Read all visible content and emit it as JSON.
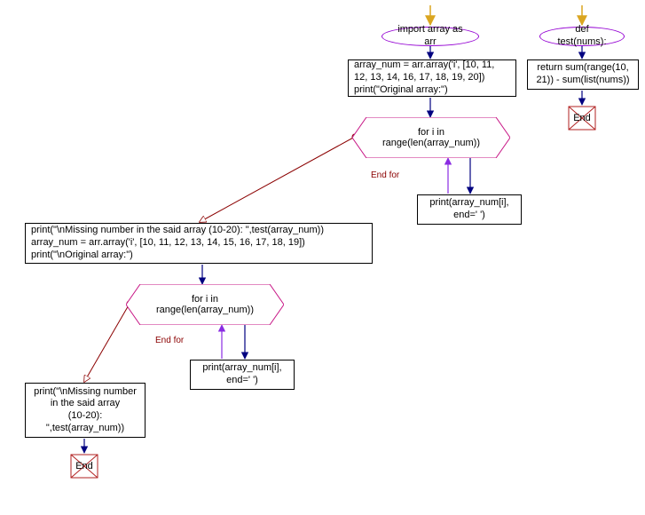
{
  "main": {
    "entry": "import array as arr",
    "block1": "array_num = arr.array('i', [10, 11, 12, 13, 14, 16, 17, 18, 19, 20])\nprint(\"Original array:\")",
    "loop1": "for i in\nrange(len(array_num))",
    "loop1_body": "print(array_num[i],\nend=' ')",
    "loop1_end_label": "End for",
    "block2": "print(\"\\nMissing number in the said array (10-20): \",test(array_num))\narray_num = arr.array('i', [10, 11, 12, 13, 14, 15, 16, 17, 18, 19])\nprint(\"\\nOriginal array:\")",
    "loop2": "for i in\nrange(len(array_num))",
    "loop2_body": "print(array_num[i],\nend=' ')",
    "loop2_end_label": "End for",
    "block3": "print(\"\\nMissing number\nin the said array\n(10-20):\n\",test(array_num))",
    "end": "End"
  },
  "func": {
    "def": "def test(nums):",
    "body": "return sum(range(10,\n21)) - sum(list(nums))",
    "end": "End"
  },
  "colors": {
    "oval_border": "#9400d3",
    "hex_border": "#c71585",
    "end_border": "#b22222",
    "arrow": "#000080",
    "flow": "#8b0000",
    "entry": "#daa520",
    "loop_back": "#8a2be2"
  }
}
